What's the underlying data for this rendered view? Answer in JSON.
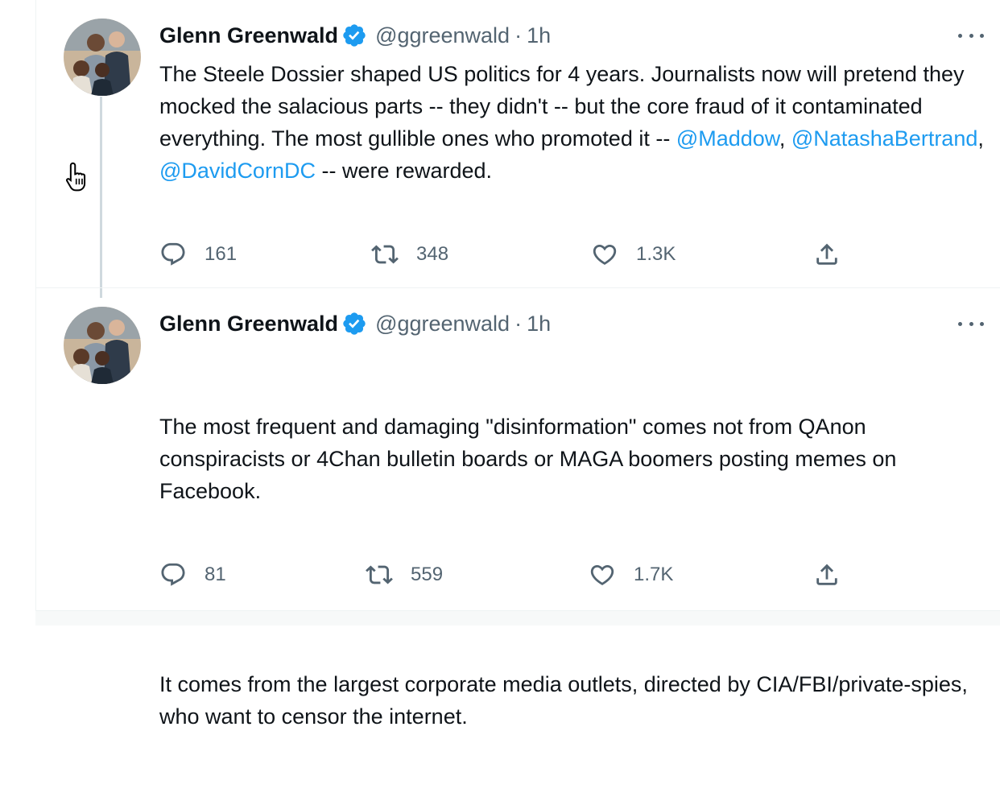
{
  "tweets": [
    {
      "author": {
        "name": "Glenn Greenwald",
        "handle": "@ggreenwald",
        "separator": "·",
        "time": "1h",
        "verified": true
      },
      "text": {
        "before": "The Steele Dossier shaped US politics for 4 years. Journalists now will pretend they mocked the salacious parts -- they didn't -- but the core fraud of it contaminated everything. The most gullible ones who promoted it -- ",
        "mention1": "@Maddow",
        "sep1": ", ",
        "mention2": "@NatashaBertrand",
        "sep2": ", ",
        "mention3": "@DavidCornDC",
        "after": " -- were rewarded."
      },
      "stats": {
        "replies": "161",
        "retweets": "348",
        "likes": "1.3K"
      }
    },
    {
      "author": {
        "name": "Glenn Greenwald",
        "handle": "@ggreenwald",
        "separator": "·",
        "time": "1h",
        "verified": true
      },
      "text": {
        "paragraph1": "The most frequent and damaging \"disinformation\" comes not from QAnon conspiracists or 4Chan bulletin boards or MAGA boomers posting memes on Facebook.",
        "paragraph2": "It comes from the largest corporate media outlets, directed by CIA/FBI/private-spies, who want to censor the internet."
      },
      "stats": {
        "replies": "81",
        "retweets": "559",
        "likes": "1.7K"
      }
    }
  ],
  "icons": {
    "reply": "reply-icon",
    "retweet": "retweet-icon",
    "like": "like-icon",
    "share": "share-icon",
    "more": "more-icon",
    "verified": "verified-badge-icon",
    "cursor": "hand-cursor-icon"
  },
  "colors": {
    "accent": "#1d9bf0",
    "text": "#0f1419",
    "secondary": "#536471",
    "thread_line": "#cfd9de",
    "divider": "#eff3f4"
  }
}
